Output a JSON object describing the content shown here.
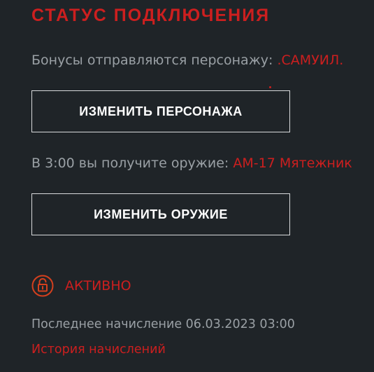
{
  "section_title": "СТАТУС ПОДКЛЮЧЕНИЯ",
  "bonus": {
    "prefix": "Бонусы отправляются персонажу: ",
    "character": ".САМУИЛ."
  },
  "change_character_button": "ИЗМЕНИТЬ ПЕРСОНАЖА",
  "weapon": {
    "prefix": "В 3:00 вы получите оружие: ",
    "name": "АМ-17 Мятежник"
  },
  "change_weapon_button": "ИЗМЕНИТЬ ОРУЖИЕ",
  "status": {
    "label": "АКТИВНО",
    "icon": "unlock-icon"
  },
  "last_accrual": "Последнее начисление 06.03.2023 03:00",
  "history_link": "История начислений",
  "colors": {
    "background": "#1f2428",
    "accent_red": "#cc1f1f",
    "status_orange": "#d4401e",
    "text_gray": "#9aa0a5",
    "button_border": "#d8dadc",
    "button_text": "#ffffff"
  }
}
